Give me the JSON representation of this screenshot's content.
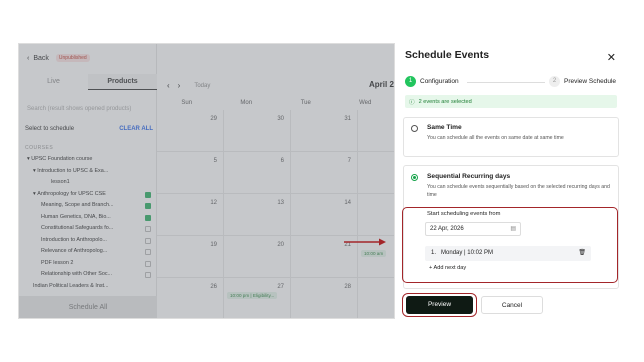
{
  "sidebar": {
    "back_label": "Back",
    "badge": "Unpublished",
    "tabs": [
      "Live",
      "Products"
    ],
    "search_placeholder": "Search (result shows opened products)",
    "select_label": "Select to schedule",
    "clear_all": "CLEAR ALL",
    "courses_heading": "COURSES",
    "items": [
      {
        "label": "UPSC Foundation course",
        "checked": false
      },
      {
        "label": "Introduction to UPSC & Exa...",
        "checked": false
      },
      {
        "label": "lesson1",
        "checked": false
      },
      {
        "label": "Anthropology for UPSC CSE",
        "checked": true
      },
      {
        "label": "Meaning, Scope and Branch...",
        "checked": true
      },
      {
        "label": "Human Genetics, DNA, Bio...",
        "checked": true
      },
      {
        "label": "Constitutional Safeguards fo...",
        "checked": false
      },
      {
        "label": "Introduction to Anthropolo...",
        "checked": false
      },
      {
        "label": "Relevance of Anthropolog...",
        "checked": false
      },
      {
        "label": "PDF lesson 2",
        "checked": false
      },
      {
        "label": "Relationship with Other Soc...",
        "checked": false
      },
      {
        "label": "Indian Political Leaders & Inst...",
        "checked": false
      }
    ],
    "schedule_all": "Schedule All"
  },
  "calendar": {
    "today": "Today",
    "month": "April 2026",
    "weekdays": [
      "Sun",
      "Mon",
      "Tue",
      "Wed"
    ],
    "weeks": [
      [
        "29",
        "30",
        "31",
        "1"
      ],
      [
        "5",
        "6",
        "7",
        "8"
      ],
      [
        "12",
        "13",
        "14",
        "15"
      ],
      [
        "19",
        "20",
        "21",
        "22"
      ],
      [
        "26",
        "27",
        "28",
        "29"
      ]
    ],
    "event_1": "10:00 am",
    "event_2": "10:00 pm | Eligibility..."
  },
  "modal": {
    "title": "Schedule Events",
    "close_icon": "close-icon",
    "step1": {
      "num": "1",
      "label": "Configuration"
    },
    "step2": {
      "num": "2",
      "label": "Preview Schedule"
    },
    "alert": "2 events are selected",
    "option1": {
      "title": "Same Time",
      "desc": "You can schedule all the events on same date at same time"
    },
    "option2": {
      "title": "Sequential Recurring days",
      "desc": "You can schedule events sequentially based on the selected recurring days and time"
    },
    "start_label": "Start scheduling events from",
    "start_date": "22 Apr, 2026",
    "row_num": "1.",
    "row_value": "Monday | 10:02 PM",
    "add_next": "+ Add next day",
    "preview": "Preview",
    "cancel": "Cancel"
  },
  "colors": {
    "accent": "#22c55e",
    "highlight": "#a3262a",
    "primary_btn": "#0f1a14"
  }
}
